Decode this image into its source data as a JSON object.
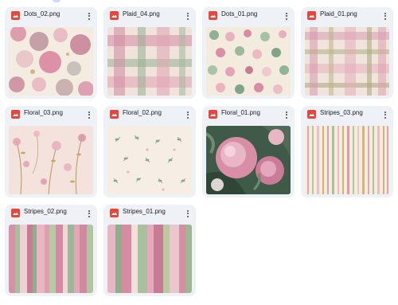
{
  "files": [
    {
      "name": "Dots_02.png",
      "thumbnail": "pink-green-watercolor-dots-large"
    },
    {
      "name": "Plaid_04.png",
      "thumbnail": "pink-green-watercolor-plaid"
    },
    {
      "name": "Dots_01.png",
      "thumbnail": "pink-green-watercolor-dots-small"
    },
    {
      "name": "Plaid_01.png",
      "thumbnail": "pink-olive-watercolor-plaid"
    },
    {
      "name": "Floral_03.png",
      "thumbnail": "pink-gold-floral-sprigs"
    },
    {
      "name": "Floral_02.png",
      "thumbnail": "green-leaf-sprigs-on-cream"
    },
    {
      "name": "Floral_01.png",
      "thumbnail": "pink-peony-painting"
    },
    {
      "name": "Stripes_03.png",
      "thumbnail": "thin-pastel-stripes"
    },
    {
      "name": "Stripes_02.png",
      "thumbnail": "pink-green-brush-stripes"
    },
    {
      "name": "Stripes_01.png",
      "thumbnail": "wide-pastel-brush-stripes"
    }
  ],
  "icons": {
    "file_type": "image-file-icon",
    "menu": "more-vert-icon"
  },
  "colors": {
    "card_background": "#eef1f6",
    "file_icon": "#e8453c"
  }
}
